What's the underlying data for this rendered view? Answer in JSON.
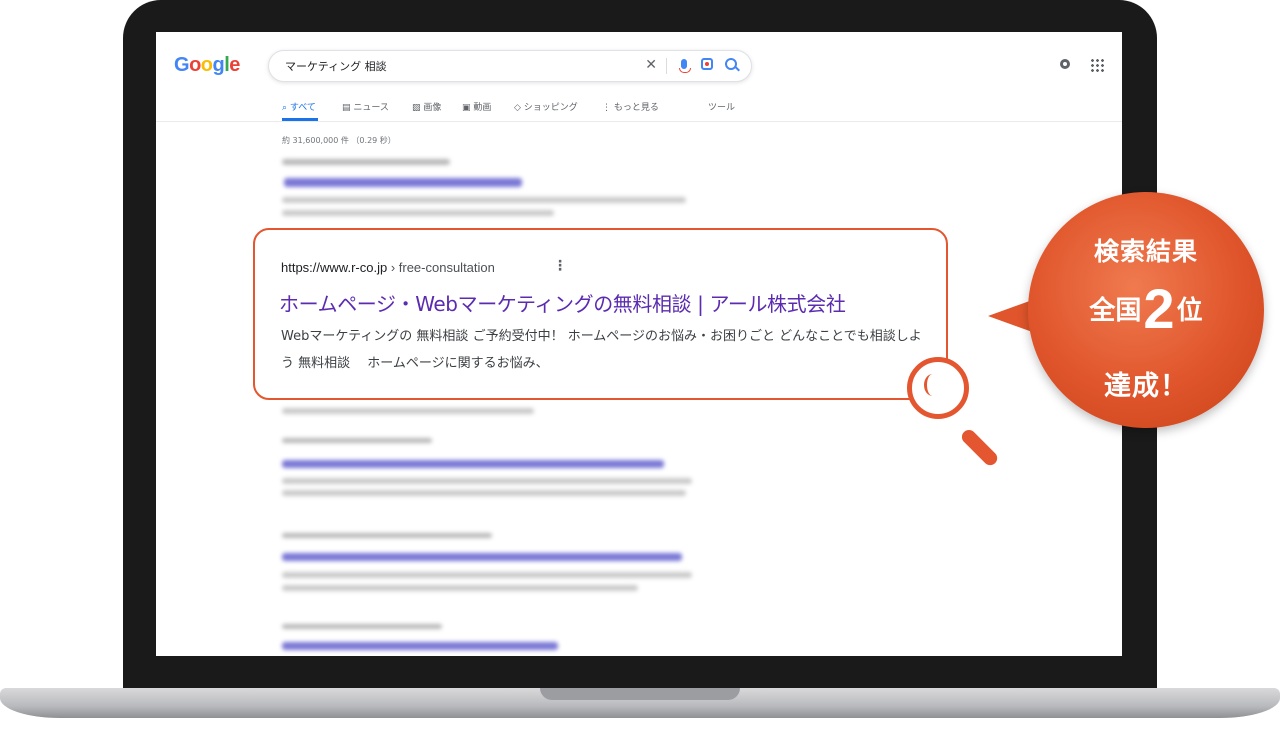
{
  "google": {
    "logo_letters": [
      "G",
      "o",
      "o",
      "g",
      "l",
      "e"
    ],
    "search_query": "マーケティング 相談",
    "clear_glyph": "✕"
  },
  "tabs": [
    {
      "label": "すべて",
      "icon": "search-icon"
    },
    {
      "label": "ニュース",
      "icon": "news-icon"
    },
    {
      "label": "画像",
      "icon": "image-icon"
    },
    {
      "label": "動画",
      "icon": "video-icon"
    },
    {
      "label": "ショッピング",
      "icon": "shopping-icon"
    },
    {
      "label": "もっと見る",
      "icon": "more-icon"
    },
    {
      "label": "ツール",
      "icon": ""
    }
  ],
  "result_stats": "約 31,600,000 件 （0.29 秒）",
  "highlighted_result": {
    "url_host": "https://www.r-co.jp",
    "url_path": " › free-consultation",
    "menu_glyph": "⋮",
    "title": "ホームページ・Webマーケティングの無料相談 | アール株式会社",
    "snippet": "Webマーケティングの 無料相談 ご予約受付中！ ホームページのお悩み・お困りごと どんなことでも相談しよう 無料相談　 ホームページに関するお悩み、"
  },
  "badge": {
    "line1": "検索結果",
    "line2_prefix": "全国",
    "line2_number": "2",
    "line2_suffix": "位",
    "line3": "達成！"
  },
  "colors": {
    "accent": "#e4562f",
    "link_visited": "#5b2bb0",
    "google_blue": "#1a73e8"
  }
}
